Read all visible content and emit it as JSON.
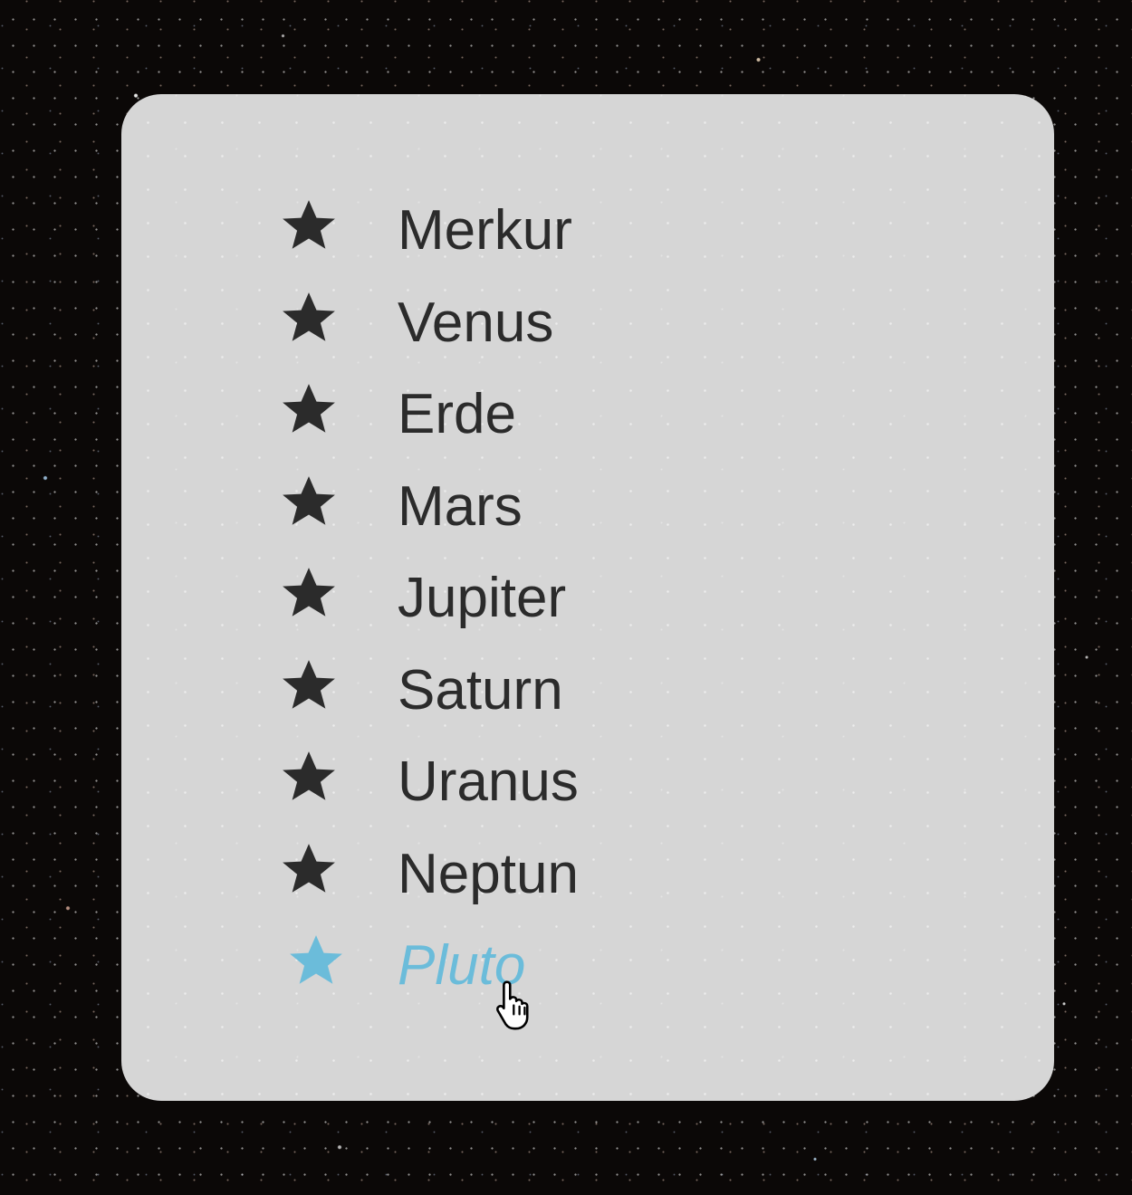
{
  "background": {
    "name": "deep-space-starfield"
  },
  "planets": {
    "items": [
      {
        "label": "Merkur",
        "icon": "star-icon",
        "hovered": false
      },
      {
        "label": "Venus",
        "icon": "star-icon",
        "hovered": false
      },
      {
        "label": "Erde",
        "icon": "star-icon",
        "hovered": false
      },
      {
        "label": "Mars",
        "icon": "star-icon",
        "hovered": false
      },
      {
        "label": "Jupiter",
        "icon": "star-icon",
        "hovered": false
      },
      {
        "label": "Saturn",
        "icon": "star-icon",
        "hovered": false
      },
      {
        "label": "Uranus",
        "icon": "star-icon",
        "hovered": false
      },
      {
        "label": "Neptun",
        "icon": "star-icon",
        "hovered": false
      },
      {
        "label": "Pluto",
        "icon": "star-icon",
        "hovered": true
      }
    ]
  },
  "colors": {
    "text": "#2b2b2b",
    "hover_accent": "#6bbcda",
    "card_background": "#d6d6d6"
  },
  "cursor": {
    "icon": "hand-pointer-icon"
  }
}
